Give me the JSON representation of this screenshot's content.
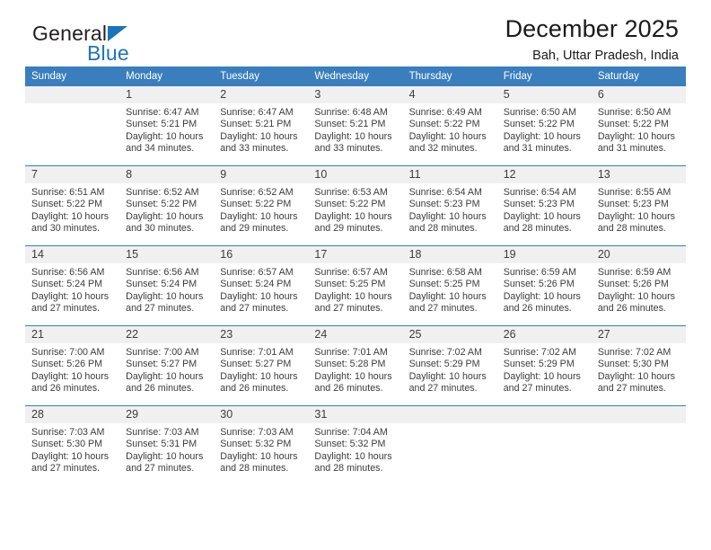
{
  "brand": {
    "name_part1": "General",
    "name_part2": "Blue",
    "logo_icon": "triangle-flag-icon"
  },
  "header": {
    "title": "December 2025",
    "subtitle": "Bah, Uttar Pradesh, India"
  },
  "colors": {
    "header_blue": "#3a7ebe",
    "brand_blue": "#1b75bb",
    "daynum_band": "#f0f0f0",
    "text": "#3c3c3c"
  },
  "calendar": {
    "weekdays": [
      "Sunday",
      "Monday",
      "Tuesday",
      "Wednesday",
      "Thursday",
      "Friday",
      "Saturday"
    ],
    "weeks": [
      [
        {
          "day": "",
          "lines": []
        },
        {
          "day": "1",
          "lines": [
            "Sunrise: 6:47 AM",
            "Sunset: 5:21 PM",
            "Daylight: 10 hours",
            "and 34 minutes."
          ]
        },
        {
          "day": "2",
          "lines": [
            "Sunrise: 6:47 AM",
            "Sunset: 5:21 PM",
            "Daylight: 10 hours",
            "and 33 minutes."
          ]
        },
        {
          "day": "3",
          "lines": [
            "Sunrise: 6:48 AM",
            "Sunset: 5:21 PM",
            "Daylight: 10 hours",
            "and 33 minutes."
          ]
        },
        {
          "day": "4",
          "lines": [
            "Sunrise: 6:49 AM",
            "Sunset: 5:22 PM",
            "Daylight: 10 hours",
            "and 32 minutes."
          ]
        },
        {
          "day": "5",
          "lines": [
            "Sunrise: 6:50 AM",
            "Sunset: 5:22 PM",
            "Daylight: 10 hours",
            "and 31 minutes."
          ]
        },
        {
          "day": "6",
          "lines": [
            "Sunrise: 6:50 AM",
            "Sunset: 5:22 PM",
            "Daylight: 10 hours",
            "and 31 minutes."
          ]
        }
      ],
      [
        {
          "day": "7",
          "lines": [
            "Sunrise: 6:51 AM",
            "Sunset: 5:22 PM",
            "Daylight: 10 hours",
            "and 30 minutes."
          ]
        },
        {
          "day": "8",
          "lines": [
            "Sunrise: 6:52 AM",
            "Sunset: 5:22 PM",
            "Daylight: 10 hours",
            "and 30 minutes."
          ]
        },
        {
          "day": "9",
          "lines": [
            "Sunrise: 6:52 AM",
            "Sunset: 5:22 PM",
            "Daylight: 10 hours",
            "and 29 minutes."
          ]
        },
        {
          "day": "10",
          "lines": [
            "Sunrise: 6:53 AM",
            "Sunset: 5:22 PM",
            "Daylight: 10 hours",
            "and 29 minutes."
          ]
        },
        {
          "day": "11",
          "lines": [
            "Sunrise: 6:54 AM",
            "Sunset: 5:23 PM",
            "Daylight: 10 hours",
            "and 28 minutes."
          ]
        },
        {
          "day": "12",
          "lines": [
            "Sunrise: 6:54 AM",
            "Sunset: 5:23 PM",
            "Daylight: 10 hours",
            "and 28 minutes."
          ]
        },
        {
          "day": "13",
          "lines": [
            "Sunrise: 6:55 AM",
            "Sunset: 5:23 PM",
            "Daylight: 10 hours",
            "and 28 minutes."
          ]
        }
      ],
      [
        {
          "day": "14",
          "lines": [
            "Sunrise: 6:56 AM",
            "Sunset: 5:24 PM",
            "Daylight: 10 hours",
            "and 27 minutes."
          ]
        },
        {
          "day": "15",
          "lines": [
            "Sunrise: 6:56 AM",
            "Sunset: 5:24 PM",
            "Daylight: 10 hours",
            "and 27 minutes."
          ]
        },
        {
          "day": "16",
          "lines": [
            "Sunrise: 6:57 AM",
            "Sunset: 5:24 PM",
            "Daylight: 10 hours",
            "and 27 minutes."
          ]
        },
        {
          "day": "17",
          "lines": [
            "Sunrise: 6:57 AM",
            "Sunset: 5:25 PM",
            "Daylight: 10 hours",
            "and 27 minutes."
          ]
        },
        {
          "day": "18",
          "lines": [
            "Sunrise: 6:58 AM",
            "Sunset: 5:25 PM",
            "Daylight: 10 hours",
            "and 27 minutes."
          ]
        },
        {
          "day": "19",
          "lines": [
            "Sunrise: 6:59 AM",
            "Sunset: 5:26 PM",
            "Daylight: 10 hours",
            "and 26 minutes."
          ]
        },
        {
          "day": "20",
          "lines": [
            "Sunrise: 6:59 AM",
            "Sunset: 5:26 PM",
            "Daylight: 10 hours",
            "and 26 minutes."
          ]
        }
      ],
      [
        {
          "day": "21",
          "lines": [
            "Sunrise: 7:00 AM",
            "Sunset: 5:26 PM",
            "Daylight: 10 hours",
            "and 26 minutes."
          ]
        },
        {
          "day": "22",
          "lines": [
            "Sunrise: 7:00 AM",
            "Sunset: 5:27 PM",
            "Daylight: 10 hours",
            "and 26 minutes."
          ]
        },
        {
          "day": "23",
          "lines": [
            "Sunrise: 7:01 AM",
            "Sunset: 5:27 PM",
            "Daylight: 10 hours",
            "and 26 minutes."
          ]
        },
        {
          "day": "24",
          "lines": [
            "Sunrise: 7:01 AM",
            "Sunset: 5:28 PM",
            "Daylight: 10 hours",
            "and 26 minutes."
          ]
        },
        {
          "day": "25",
          "lines": [
            "Sunrise: 7:02 AM",
            "Sunset: 5:29 PM",
            "Daylight: 10 hours",
            "and 27 minutes."
          ]
        },
        {
          "day": "26",
          "lines": [
            "Sunrise: 7:02 AM",
            "Sunset: 5:29 PM",
            "Daylight: 10 hours",
            "and 27 minutes."
          ]
        },
        {
          "day": "27",
          "lines": [
            "Sunrise: 7:02 AM",
            "Sunset: 5:30 PM",
            "Daylight: 10 hours",
            "and 27 minutes."
          ]
        }
      ],
      [
        {
          "day": "28",
          "lines": [
            "Sunrise: 7:03 AM",
            "Sunset: 5:30 PM",
            "Daylight: 10 hours",
            "and 27 minutes."
          ]
        },
        {
          "day": "29",
          "lines": [
            "Sunrise: 7:03 AM",
            "Sunset: 5:31 PM",
            "Daylight: 10 hours",
            "and 27 minutes."
          ]
        },
        {
          "day": "30",
          "lines": [
            "Sunrise: 7:03 AM",
            "Sunset: 5:32 PM",
            "Daylight: 10 hours",
            "and 28 minutes."
          ]
        },
        {
          "day": "31",
          "lines": [
            "Sunrise: 7:04 AM",
            "Sunset: 5:32 PM",
            "Daylight: 10 hours",
            "and 28 minutes."
          ]
        },
        {
          "day": "",
          "lines": []
        },
        {
          "day": "",
          "lines": []
        },
        {
          "day": "",
          "lines": []
        }
      ]
    ]
  }
}
